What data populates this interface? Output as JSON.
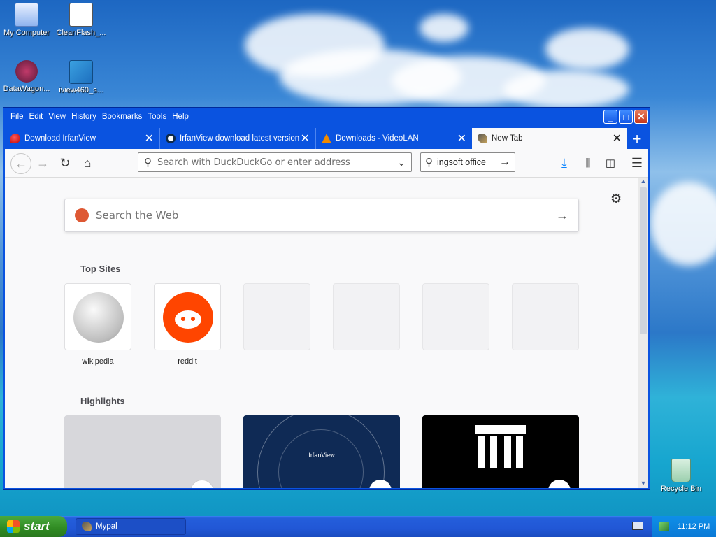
{
  "desktop": {
    "icons": [
      {
        "label": "My Computer"
      },
      {
        "label": "CleanFlash_..."
      },
      {
        "label": "DataWagon..."
      },
      {
        "label": "iview460_s..."
      },
      {
        "label": "Recycle Bin"
      }
    ]
  },
  "browser": {
    "menu": [
      "File",
      "Edit",
      "View",
      "History",
      "Bookmarks",
      "Tools",
      "Help"
    ],
    "tabs": [
      {
        "label": "Download IrfanView"
      },
      {
        "label": "IrfanView download latest version"
      },
      {
        "label": "Downloads - VideoLAN"
      },
      {
        "label": "New Tab"
      }
    ],
    "urlbar_placeholder": "Search with DuckDuckGo or enter address",
    "searchbar_value": "ingsoft office",
    "newtab": {
      "search_placeholder": "Search the Web",
      "top_sites_title": "Top Sites",
      "top_sites": [
        {
          "label": "wikipedia"
        },
        {
          "label": "reddit"
        }
      ],
      "highlights_title": "Highlights",
      "highlight_irfan_title": "IrfanView"
    }
  },
  "taskbar": {
    "start_label": "start",
    "task_label": "Mypal",
    "clock": "11:12 PM"
  }
}
